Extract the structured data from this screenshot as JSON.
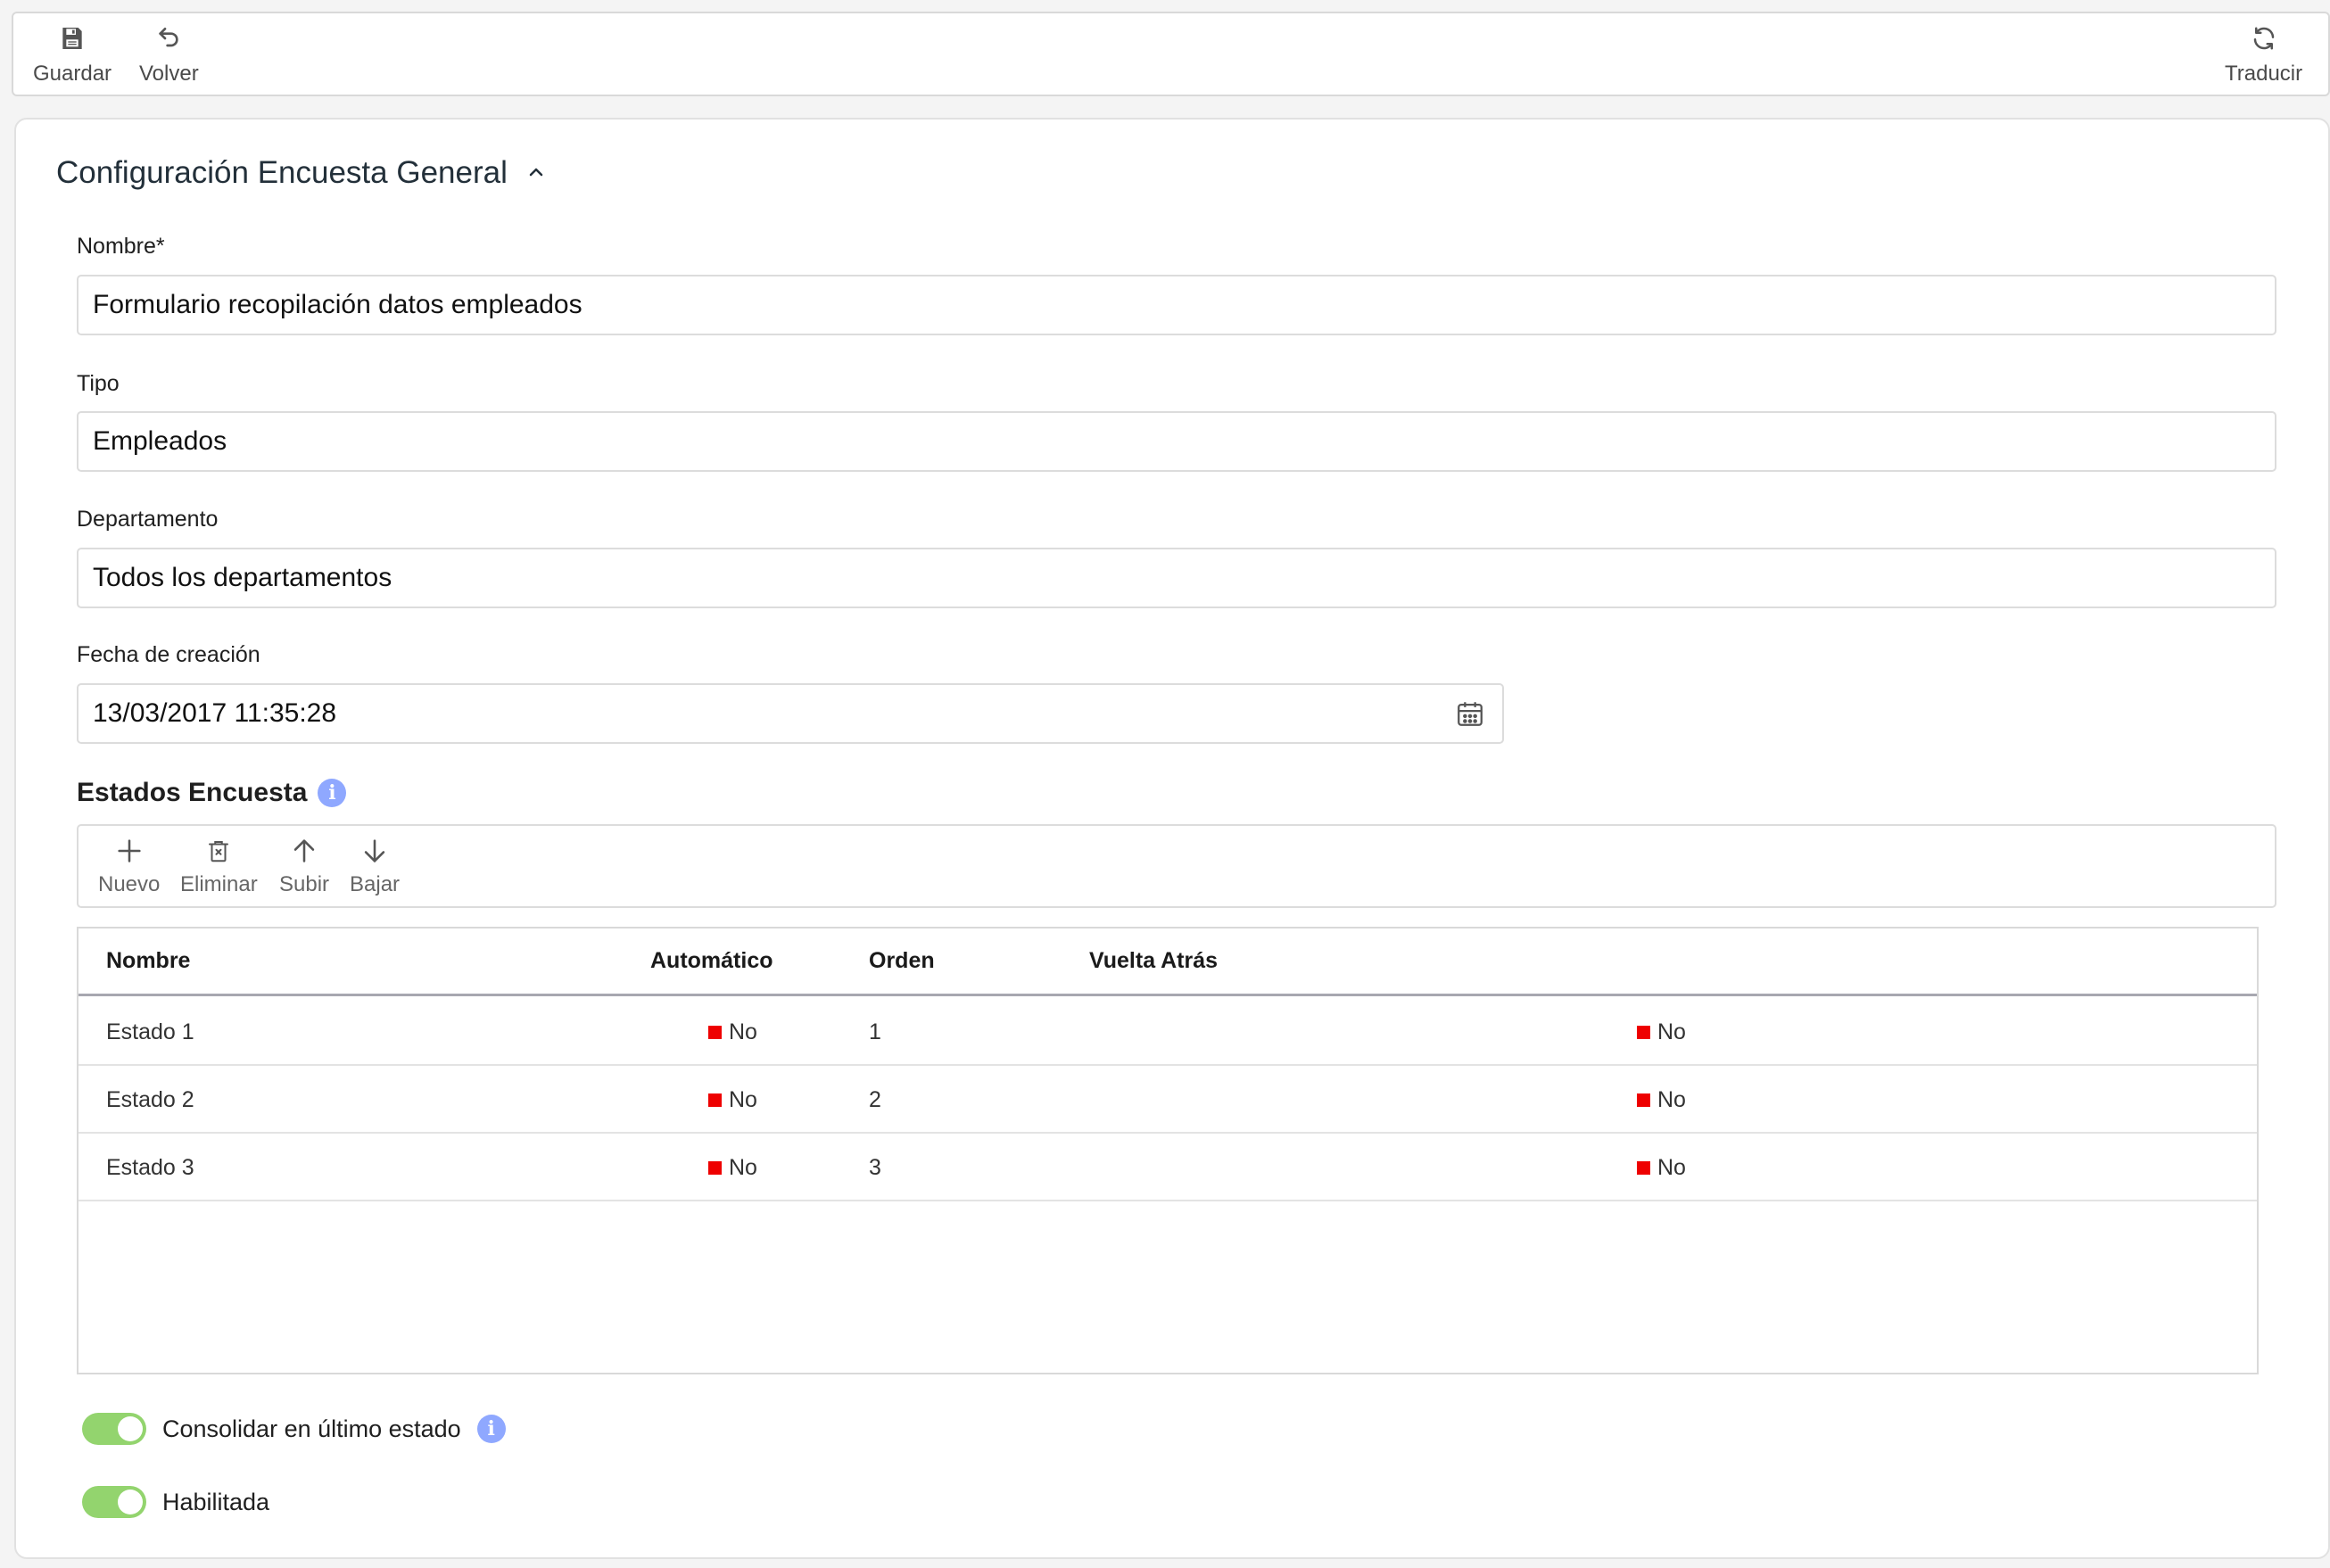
{
  "toolbar": {
    "save_label": "Guardar",
    "back_label": "Volver",
    "translate_label": "Traducir"
  },
  "section": {
    "title": "Configuración Encuesta General"
  },
  "form": {
    "nombre": {
      "label": "Nombre*",
      "value": "Formulario recopilación datos empleados"
    },
    "tipo": {
      "label": "Tipo",
      "value": "Empleados"
    },
    "departamento": {
      "label": "Departamento",
      "value": "Todos los departamentos"
    },
    "fecha": {
      "label": "Fecha de creación",
      "value": "13/03/2017 11:35:28"
    }
  },
  "estados": {
    "title": "Estados Encuesta",
    "info_glyph": "i",
    "toolbar": {
      "new_label": "Nuevo",
      "delete_label": "Eliminar",
      "up_label": "Subir",
      "down_label": "Bajar"
    },
    "columns": [
      "Nombre",
      "Automático",
      "Orden",
      "Vuelta Atrás"
    ],
    "rows": [
      {
        "nombre": "Estado 1",
        "automatico": "No",
        "orden": "1",
        "vuelta": "No"
      },
      {
        "nombre": "Estado 2",
        "automatico": "No",
        "orden": "2",
        "vuelta": "No"
      },
      {
        "nombre": "Estado 3",
        "automatico": "No",
        "orden": "3",
        "vuelta": "No"
      }
    ]
  },
  "toggles": {
    "consolidar": {
      "label": "Consolidar en último estado",
      "on": true
    },
    "habilitada": {
      "label": "Habilitada",
      "on": true
    }
  },
  "colors": {
    "toggle_on": "#93d46e",
    "status_no": "#ee0000",
    "info": "#8fa8ff"
  },
  "icons": [
    "save-icon",
    "undo-icon",
    "refresh-icon",
    "chevron-up-icon",
    "calendar-icon",
    "info-icon",
    "plus-icon",
    "trash-icon",
    "arrow-up-icon",
    "arrow-down-icon"
  ]
}
